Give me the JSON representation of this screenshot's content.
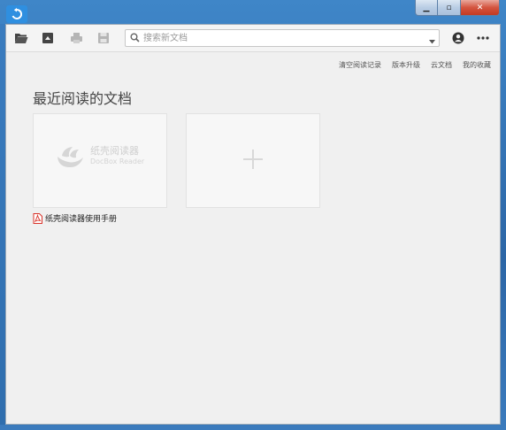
{
  "titlebar": {
    "controls": {
      "minimize": "▁",
      "maximize": "▫",
      "close": "✕"
    }
  },
  "toolbar": {
    "buttons": [
      {
        "icon": "folder-open-icon"
      },
      {
        "icon": "save-icon"
      },
      {
        "icon": "print-icon"
      },
      {
        "icon": "disk-icon"
      }
    ],
    "search": {
      "placeholder": "搜索新文档",
      "value": ""
    },
    "right_buttons": [
      {
        "icon": "account-icon"
      },
      {
        "icon": "more-icon"
      }
    ]
  },
  "top_links": [
    "清空阅读记录",
    "版本升级",
    "云文档",
    "我的收藏"
  ],
  "recent": {
    "title": "最近阅读的文档",
    "documents": [
      {
        "name": "纸壳阅读器使用手册",
        "thumbnail_title": "纸壳阅读器",
        "thumbnail_subtitle": "DocBox Reader"
      }
    ],
    "add_card": "+"
  },
  "colors": {
    "accent": "#2f8fe0",
    "pdf_red": "#d9332a",
    "window_bg": "#f0f0f0"
  }
}
